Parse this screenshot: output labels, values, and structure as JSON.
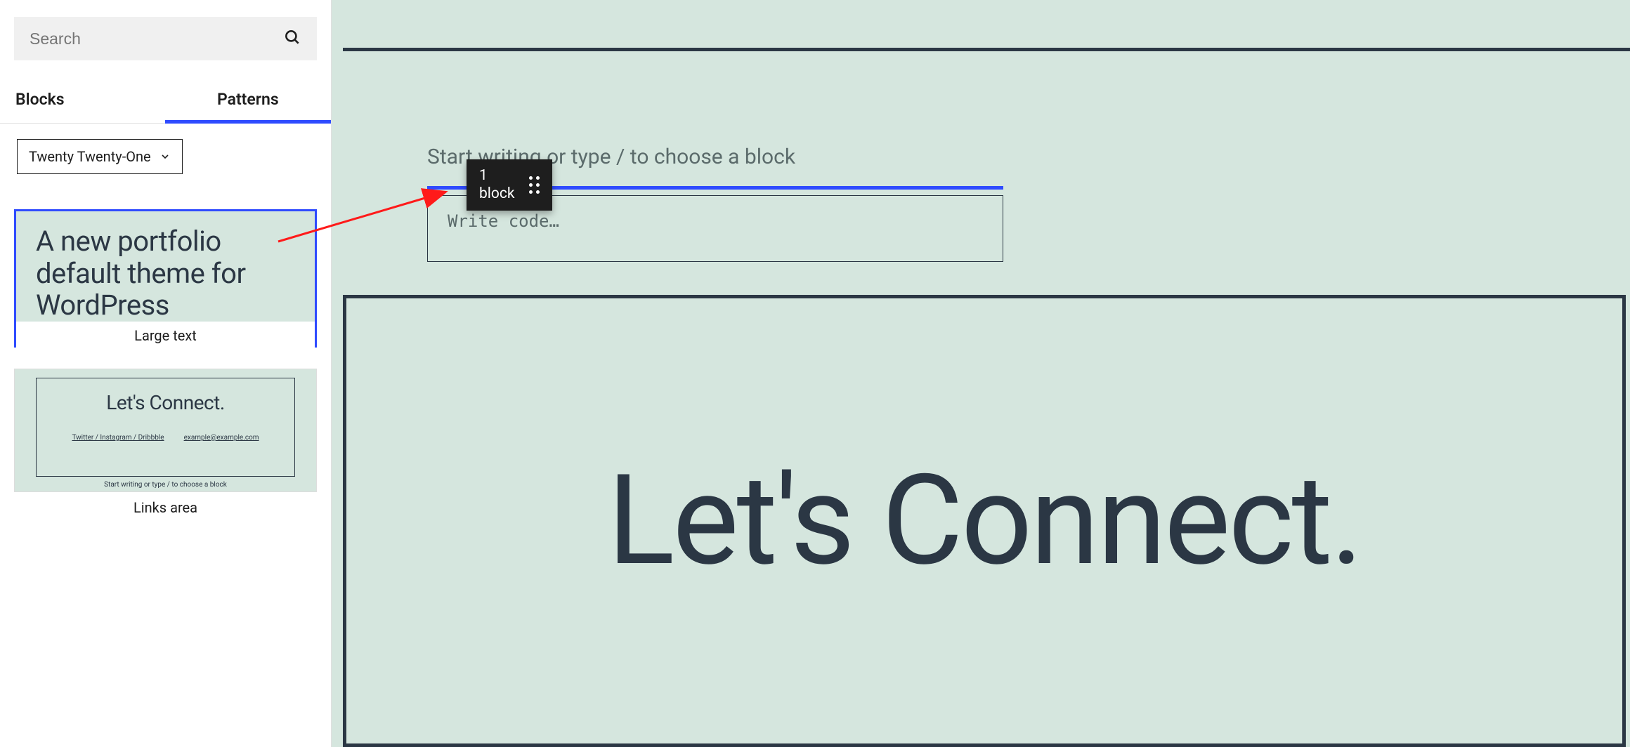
{
  "sidebar": {
    "search_placeholder": "Search",
    "tabs": {
      "blocks": "Blocks",
      "patterns": "Patterns"
    },
    "category": "Twenty Twenty-One",
    "patterns": [
      {
        "id": "large-text",
        "preview_text": "A new portfolio default theme for WordPress",
        "label": "Large text",
        "selected": true
      },
      {
        "id": "links-area",
        "title": "Let's Connect.",
        "links_left": "Twitter / Instagram / Dribbble",
        "links_right": "example@example.com",
        "placeholder": "Start writing or type / to choose a block",
        "label": "Links area",
        "selected": false
      }
    ]
  },
  "canvas": {
    "paragraph_placeholder": "Start writing or type / to choose a block",
    "drag_chip": {
      "line1": "1",
      "line2": "block"
    },
    "code_placeholder": "Write code…",
    "hero_text": "Let's Connect."
  },
  "colors": {
    "accent": "#2f4bff",
    "surface": "#d5e6de",
    "ink": "#2b3744"
  }
}
